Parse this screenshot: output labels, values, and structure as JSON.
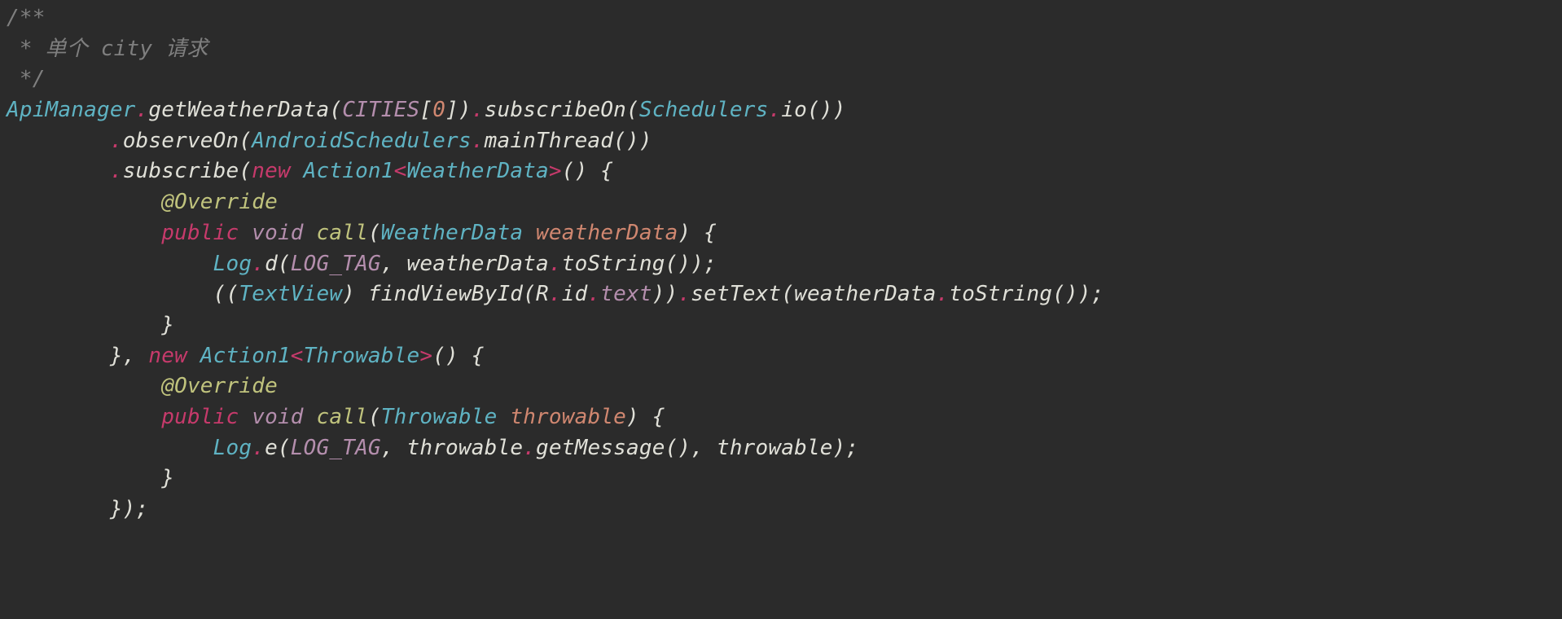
{
  "colors": {
    "background": "#2b2b2b",
    "comment": "#7f7f7f",
    "type": "#5fb3c3",
    "default": "#c8c8c8",
    "punctDot": "#c63a6b",
    "constant": "#b48ead",
    "number": "#d08770",
    "keyword": "#c63a6b",
    "annotation": "#c0c37d",
    "param": "#d08770"
  },
  "code": {
    "language": "Java",
    "lines": [
      {
        "indent": 0,
        "tokens": [
          {
            "t": "/**",
            "c": "comment"
          }
        ]
      },
      {
        "indent": 0,
        "tokens": [
          {
            "t": " * 单个 city 请求",
            "c": "comment"
          }
        ]
      },
      {
        "indent": 0,
        "tokens": [
          {
            "t": " */",
            "c": "comment"
          }
        ]
      },
      {
        "indent": 0,
        "tokens": [
          {
            "t": "ApiManager",
            "c": "type"
          },
          {
            "t": ".",
            "c": "dot"
          },
          {
            "t": "getWeatherData(",
            "c": "method"
          },
          {
            "t": "CITIES",
            "c": "constant"
          },
          {
            "t": "[",
            "c": "method"
          },
          {
            "t": "0",
            "c": "number"
          },
          {
            "t": "])",
            "c": "method"
          },
          {
            "t": ".",
            "c": "dot"
          },
          {
            "t": "subscribeOn(",
            "c": "method"
          },
          {
            "t": "Schedulers",
            "c": "type"
          },
          {
            "t": ".",
            "c": "dot"
          },
          {
            "t": "io())",
            "c": "method"
          }
        ]
      },
      {
        "indent": 8,
        "tokens": [
          {
            "t": ".",
            "c": "dot"
          },
          {
            "t": "observeOn(",
            "c": "method"
          },
          {
            "t": "AndroidSchedulers",
            "c": "type"
          },
          {
            "t": ".",
            "c": "dot"
          },
          {
            "t": "mainThread())",
            "c": "method"
          }
        ]
      },
      {
        "indent": 8,
        "tokens": [
          {
            "t": ".",
            "c": "dot"
          },
          {
            "t": "subscribe(",
            "c": "method"
          },
          {
            "t": "new",
            "c": "keyword"
          },
          {
            "t": " ",
            "c": "method"
          },
          {
            "t": "Action1",
            "c": "type"
          },
          {
            "t": "<",
            "c": "dot"
          },
          {
            "t": "WeatherData",
            "c": "type"
          },
          {
            "t": ">",
            "c": "dot"
          },
          {
            "t": "() {",
            "c": "method"
          }
        ]
      },
      {
        "indent": 12,
        "tokens": [
          {
            "t": "@Override",
            "c": "annotation"
          }
        ]
      },
      {
        "indent": 12,
        "tokens": [
          {
            "t": "public",
            "c": "keyword"
          },
          {
            "t": " ",
            "c": "method"
          },
          {
            "t": "void",
            "c": "void"
          },
          {
            "t": " ",
            "c": "method"
          },
          {
            "t": "call",
            "c": "annotation"
          },
          {
            "t": "(",
            "c": "method"
          },
          {
            "t": "WeatherData",
            "c": "type"
          },
          {
            "t": " ",
            "c": "method"
          },
          {
            "t": "weatherData",
            "c": "param"
          },
          {
            "t": ") {",
            "c": "method"
          }
        ]
      },
      {
        "indent": 16,
        "tokens": [
          {
            "t": "Log",
            "c": "type"
          },
          {
            "t": ".",
            "c": "dot"
          },
          {
            "t": "d(",
            "c": "method"
          },
          {
            "t": "LOG_TAG",
            "c": "constant"
          },
          {
            "t": ", weatherData",
            "c": "method"
          },
          {
            "t": ".",
            "c": "dot"
          },
          {
            "t": "toString());",
            "c": "method"
          }
        ]
      },
      {
        "indent": 16,
        "tokens": [
          {
            "t": "((",
            "c": "method"
          },
          {
            "t": "TextView",
            "c": "type"
          },
          {
            "t": ") findViewById(R",
            "c": "method"
          },
          {
            "t": ".",
            "c": "dot"
          },
          {
            "t": "id",
            "c": "method"
          },
          {
            "t": ".",
            "c": "dot"
          },
          {
            "t": "text",
            "c": "constant"
          },
          {
            "t": "))",
            "c": "method"
          },
          {
            "t": ".",
            "c": "dot"
          },
          {
            "t": "setText(weatherData",
            "c": "method"
          },
          {
            "t": ".",
            "c": "dot"
          },
          {
            "t": "toString());",
            "c": "method"
          }
        ]
      },
      {
        "indent": 12,
        "tokens": [
          {
            "t": "}",
            "c": "method"
          }
        ]
      },
      {
        "indent": 8,
        "tokens": [
          {
            "t": "}, ",
            "c": "method"
          },
          {
            "t": "new",
            "c": "keyword"
          },
          {
            "t": " ",
            "c": "method"
          },
          {
            "t": "Action1",
            "c": "type"
          },
          {
            "t": "<",
            "c": "dot"
          },
          {
            "t": "Throwable",
            "c": "type"
          },
          {
            "t": ">",
            "c": "dot"
          },
          {
            "t": "() {",
            "c": "method"
          }
        ]
      },
      {
        "indent": 12,
        "tokens": [
          {
            "t": "@Override",
            "c": "annotation"
          }
        ]
      },
      {
        "indent": 12,
        "tokens": [
          {
            "t": "public",
            "c": "keyword"
          },
          {
            "t": " ",
            "c": "method"
          },
          {
            "t": "void",
            "c": "void"
          },
          {
            "t": " ",
            "c": "method"
          },
          {
            "t": "call",
            "c": "annotation"
          },
          {
            "t": "(",
            "c": "method"
          },
          {
            "t": "Throwable",
            "c": "type"
          },
          {
            "t": " ",
            "c": "method"
          },
          {
            "t": "throwable",
            "c": "param"
          },
          {
            "t": ") {",
            "c": "method"
          }
        ]
      },
      {
        "indent": 16,
        "tokens": [
          {
            "t": "Log",
            "c": "type"
          },
          {
            "t": ".",
            "c": "dot"
          },
          {
            "t": "e(",
            "c": "method"
          },
          {
            "t": "LOG_TAG",
            "c": "constant"
          },
          {
            "t": ", throwable",
            "c": "method"
          },
          {
            "t": ".",
            "c": "dot"
          },
          {
            "t": "getMessage(), throwable);",
            "c": "method"
          }
        ]
      },
      {
        "indent": 12,
        "tokens": [
          {
            "t": "}",
            "c": "method"
          }
        ]
      },
      {
        "indent": 8,
        "tokens": [
          {
            "t": "});",
            "c": "method"
          }
        ]
      }
    ]
  }
}
